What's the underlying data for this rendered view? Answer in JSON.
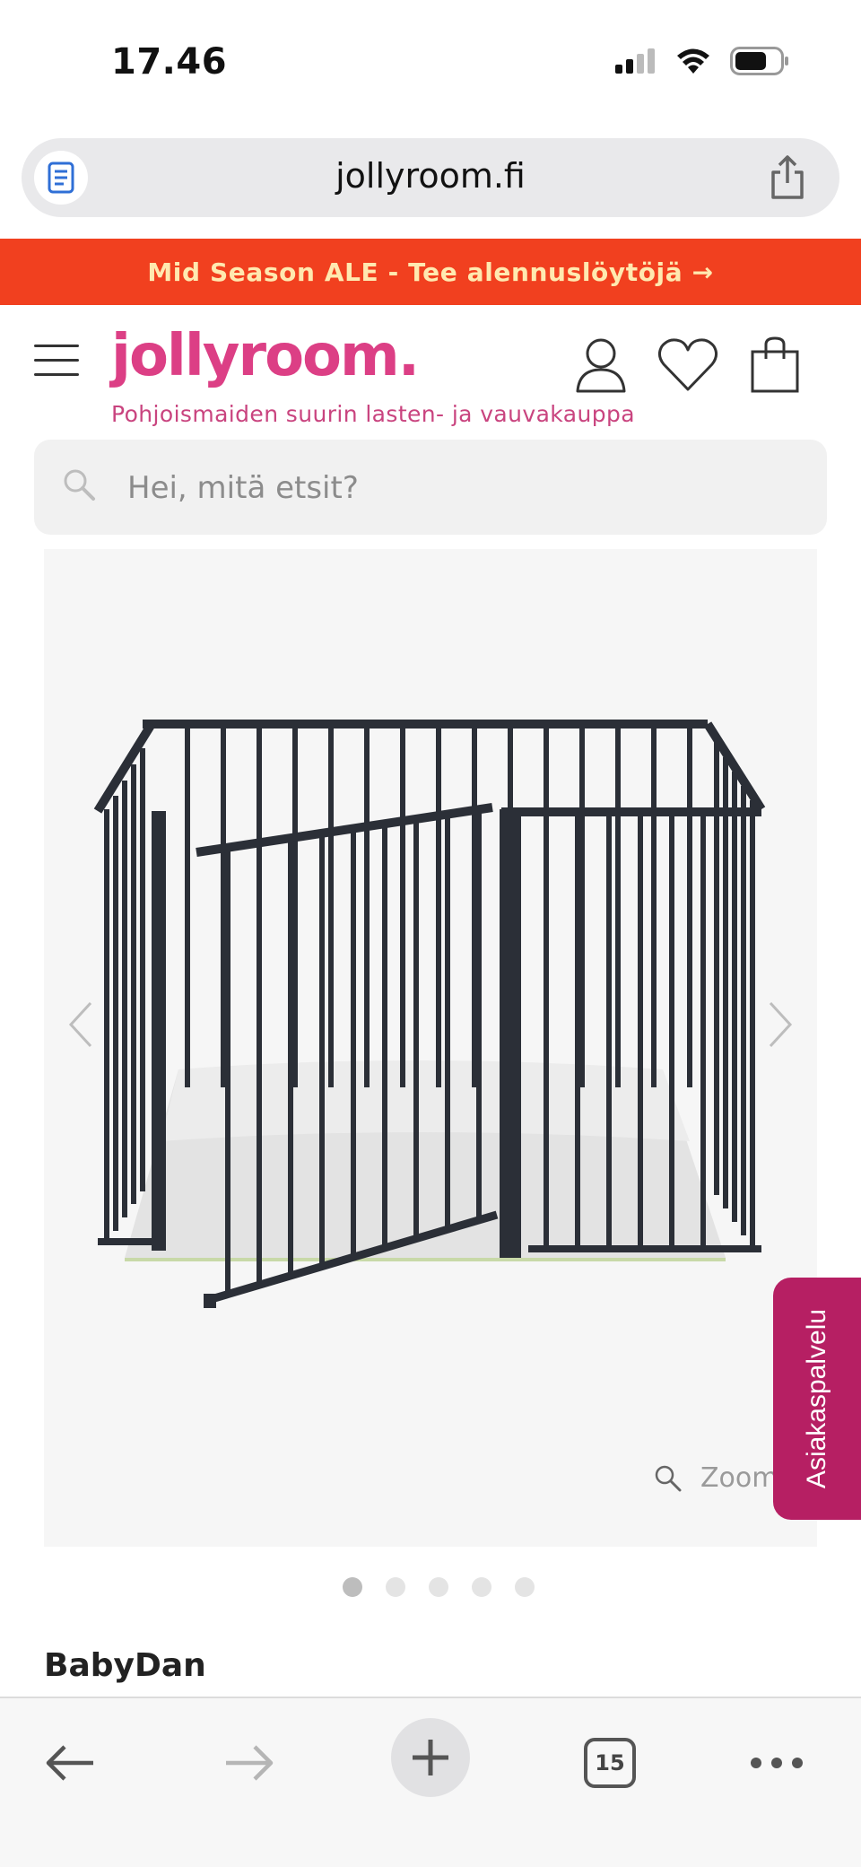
{
  "status_bar": {
    "time": "17.46"
  },
  "browser": {
    "url": "jollyroom.fi",
    "tabs_count": "15"
  },
  "promo": {
    "text": "Mid Season ALE - Tee alennuslöytöjä →"
  },
  "header": {
    "logo": "jollyroom.",
    "tagline": "Pohjoismaiden suurin lasten- ja vauvakauppa"
  },
  "search": {
    "placeholder": "Hei, mitä etsit?"
  },
  "gallery": {
    "zoom_label": "Zoom",
    "slide_count": 5,
    "active_slide": 1
  },
  "customer_service": {
    "label": "Asiakaspalvelu"
  },
  "product": {
    "brand": "BabyDan"
  },
  "colors": {
    "promo_bg": "#f1401f",
    "brand_pink": "#dc3f85",
    "service_tab": "#b61f63"
  }
}
